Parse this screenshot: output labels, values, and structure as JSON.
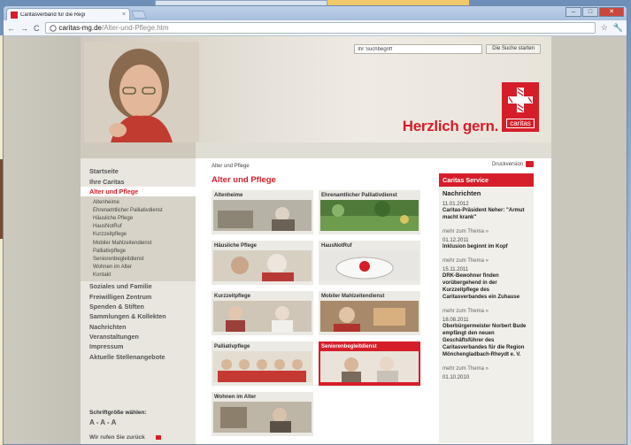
{
  "browser": {
    "tab_title": "Caritasverband für die Regi",
    "tab_close": "×",
    "url_host": "caritas-mg.de",
    "url_path": "/Alter-und-Pflege.htm",
    "win_min": "–",
    "win_max": "□",
    "win_close": "✕"
  },
  "header": {
    "search_placeholder": "Ihr Suchbegriff",
    "search_button": "Die Suche starten",
    "slogan": "Herzlich gern.",
    "logo_word": "caritas"
  },
  "sidebar": {
    "items_top": [
      "Startseite",
      "Ihre Caritas"
    ],
    "active": "Alter und Pflege",
    "subitems": [
      "Altenheime",
      "Ehrenamtlicher Palliativdienst",
      "Häusliche Pflege",
      "HausNotRuf",
      "Kurzzeitpflege",
      "Mobiler Mahlzeitendienst",
      "Palliativpflege",
      "Seniorenbegleitdienst",
      "Wohnen im Alter",
      "Kontakt"
    ],
    "items_bottom": [
      "Soziales und Familie",
      "Freiwilligen Zentrum",
      "Spenden & Stiften",
      "Sammlungen & Kollekten",
      "Nachrichten",
      "Veranstaltungen",
      "Impressum",
      "Aktuelle Stellenangebote"
    ],
    "font_label": "Schriftgröße wählen:",
    "font_options": "A - A - A",
    "callback": "Wir rufen Sie zurück"
  },
  "main": {
    "breadcrumb": "Alter und Pflege",
    "heading": "Alter und Pflege",
    "cards": [
      "Altenheime",
      "Ehrenamtlicher Palliativdienst",
      "Häusliche Pflege",
      "HausNotRuf",
      "Kurzzeitpflege",
      "Mobiler Mahlzeitendienst",
      "Palliativpflege",
      "Seniorenbegleitdienst",
      "Wohnen im Alter"
    ]
  },
  "right": {
    "print_label": "Druckversion",
    "service_title": "Caritas Service",
    "news_heading": "Nachrichten",
    "news": [
      {
        "date": "11.01.2012",
        "title": "Caritas-Präsident Neher: \"Armut macht krank\"",
        "more": "mehr zum Thema »"
      },
      {
        "date": "01.12.2011",
        "title": "Inklusion beginnt im Kopf",
        "more": "mehr zum Thema »"
      },
      {
        "date": "15.11.2011",
        "title": "DRK-Bewohner finden vorübergehend in der Kurzzeitpflege des Caritasverbandes ein Zuhause",
        "more": "mehr zum Thema »"
      },
      {
        "date": "18.08.2011",
        "title": "Oberbürgermeister Norbert Bude empfängt den neuen Geschäftsführer des Caritasverbandes für die Region Mönchengladbach-Rheydt e. V.",
        "more": "mehr zum Thema »"
      },
      {
        "date": "01.10.2010",
        "title": "",
        "more": ""
      }
    ]
  },
  "colors": {
    "brand_red": "#d51e2a",
    "sidebar_bg": "#e9e6df"
  }
}
